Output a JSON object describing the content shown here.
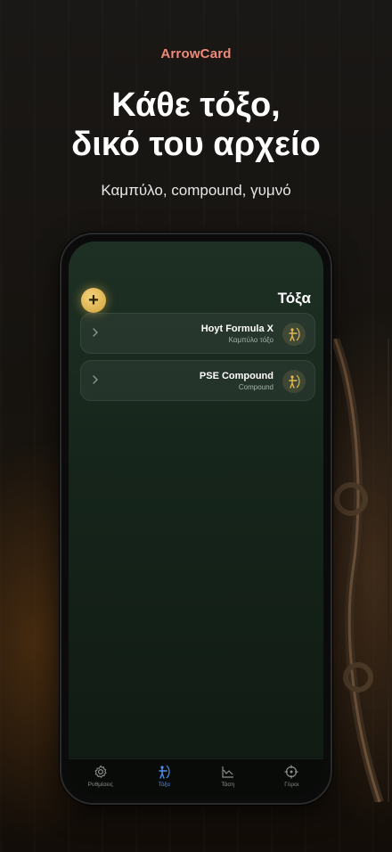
{
  "brand": "ArrowCard",
  "headline": {
    "line1": "Κάθε τόξο,",
    "line2": "δικό του αρχείο"
  },
  "subline": "Καμπύλο, compound, γυμνό",
  "screen": {
    "title": "Τόξα",
    "add_button_label": "+",
    "bows": [
      {
        "name": "Hoyt Formula X",
        "type": "Καμπύλο τόξο",
        "icon": "archer-icon"
      },
      {
        "name": "PSE Compound",
        "type": "Compound",
        "icon": "archer-icon"
      }
    ]
  },
  "tabbar": {
    "tabs": [
      {
        "label": "Ρυθμίσεις",
        "icon": "gear-icon",
        "active": false
      },
      {
        "label": "Τόξα",
        "icon": "archer-icon",
        "active": true
      },
      {
        "label": "Τάση",
        "icon": "trend-chart-icon",
        "active": false
      },
      {
        "label": "Γύροι",
        "icon": "target-icon",
        "active": false
      }
    ]
  },
  "colors": {
    "brand": "#f08a78",
    "accent_gold": "#e3b84f",
    "active_tab": "#4f8ef0",
    "screen_bg": "#1a2b20"
  }
}
